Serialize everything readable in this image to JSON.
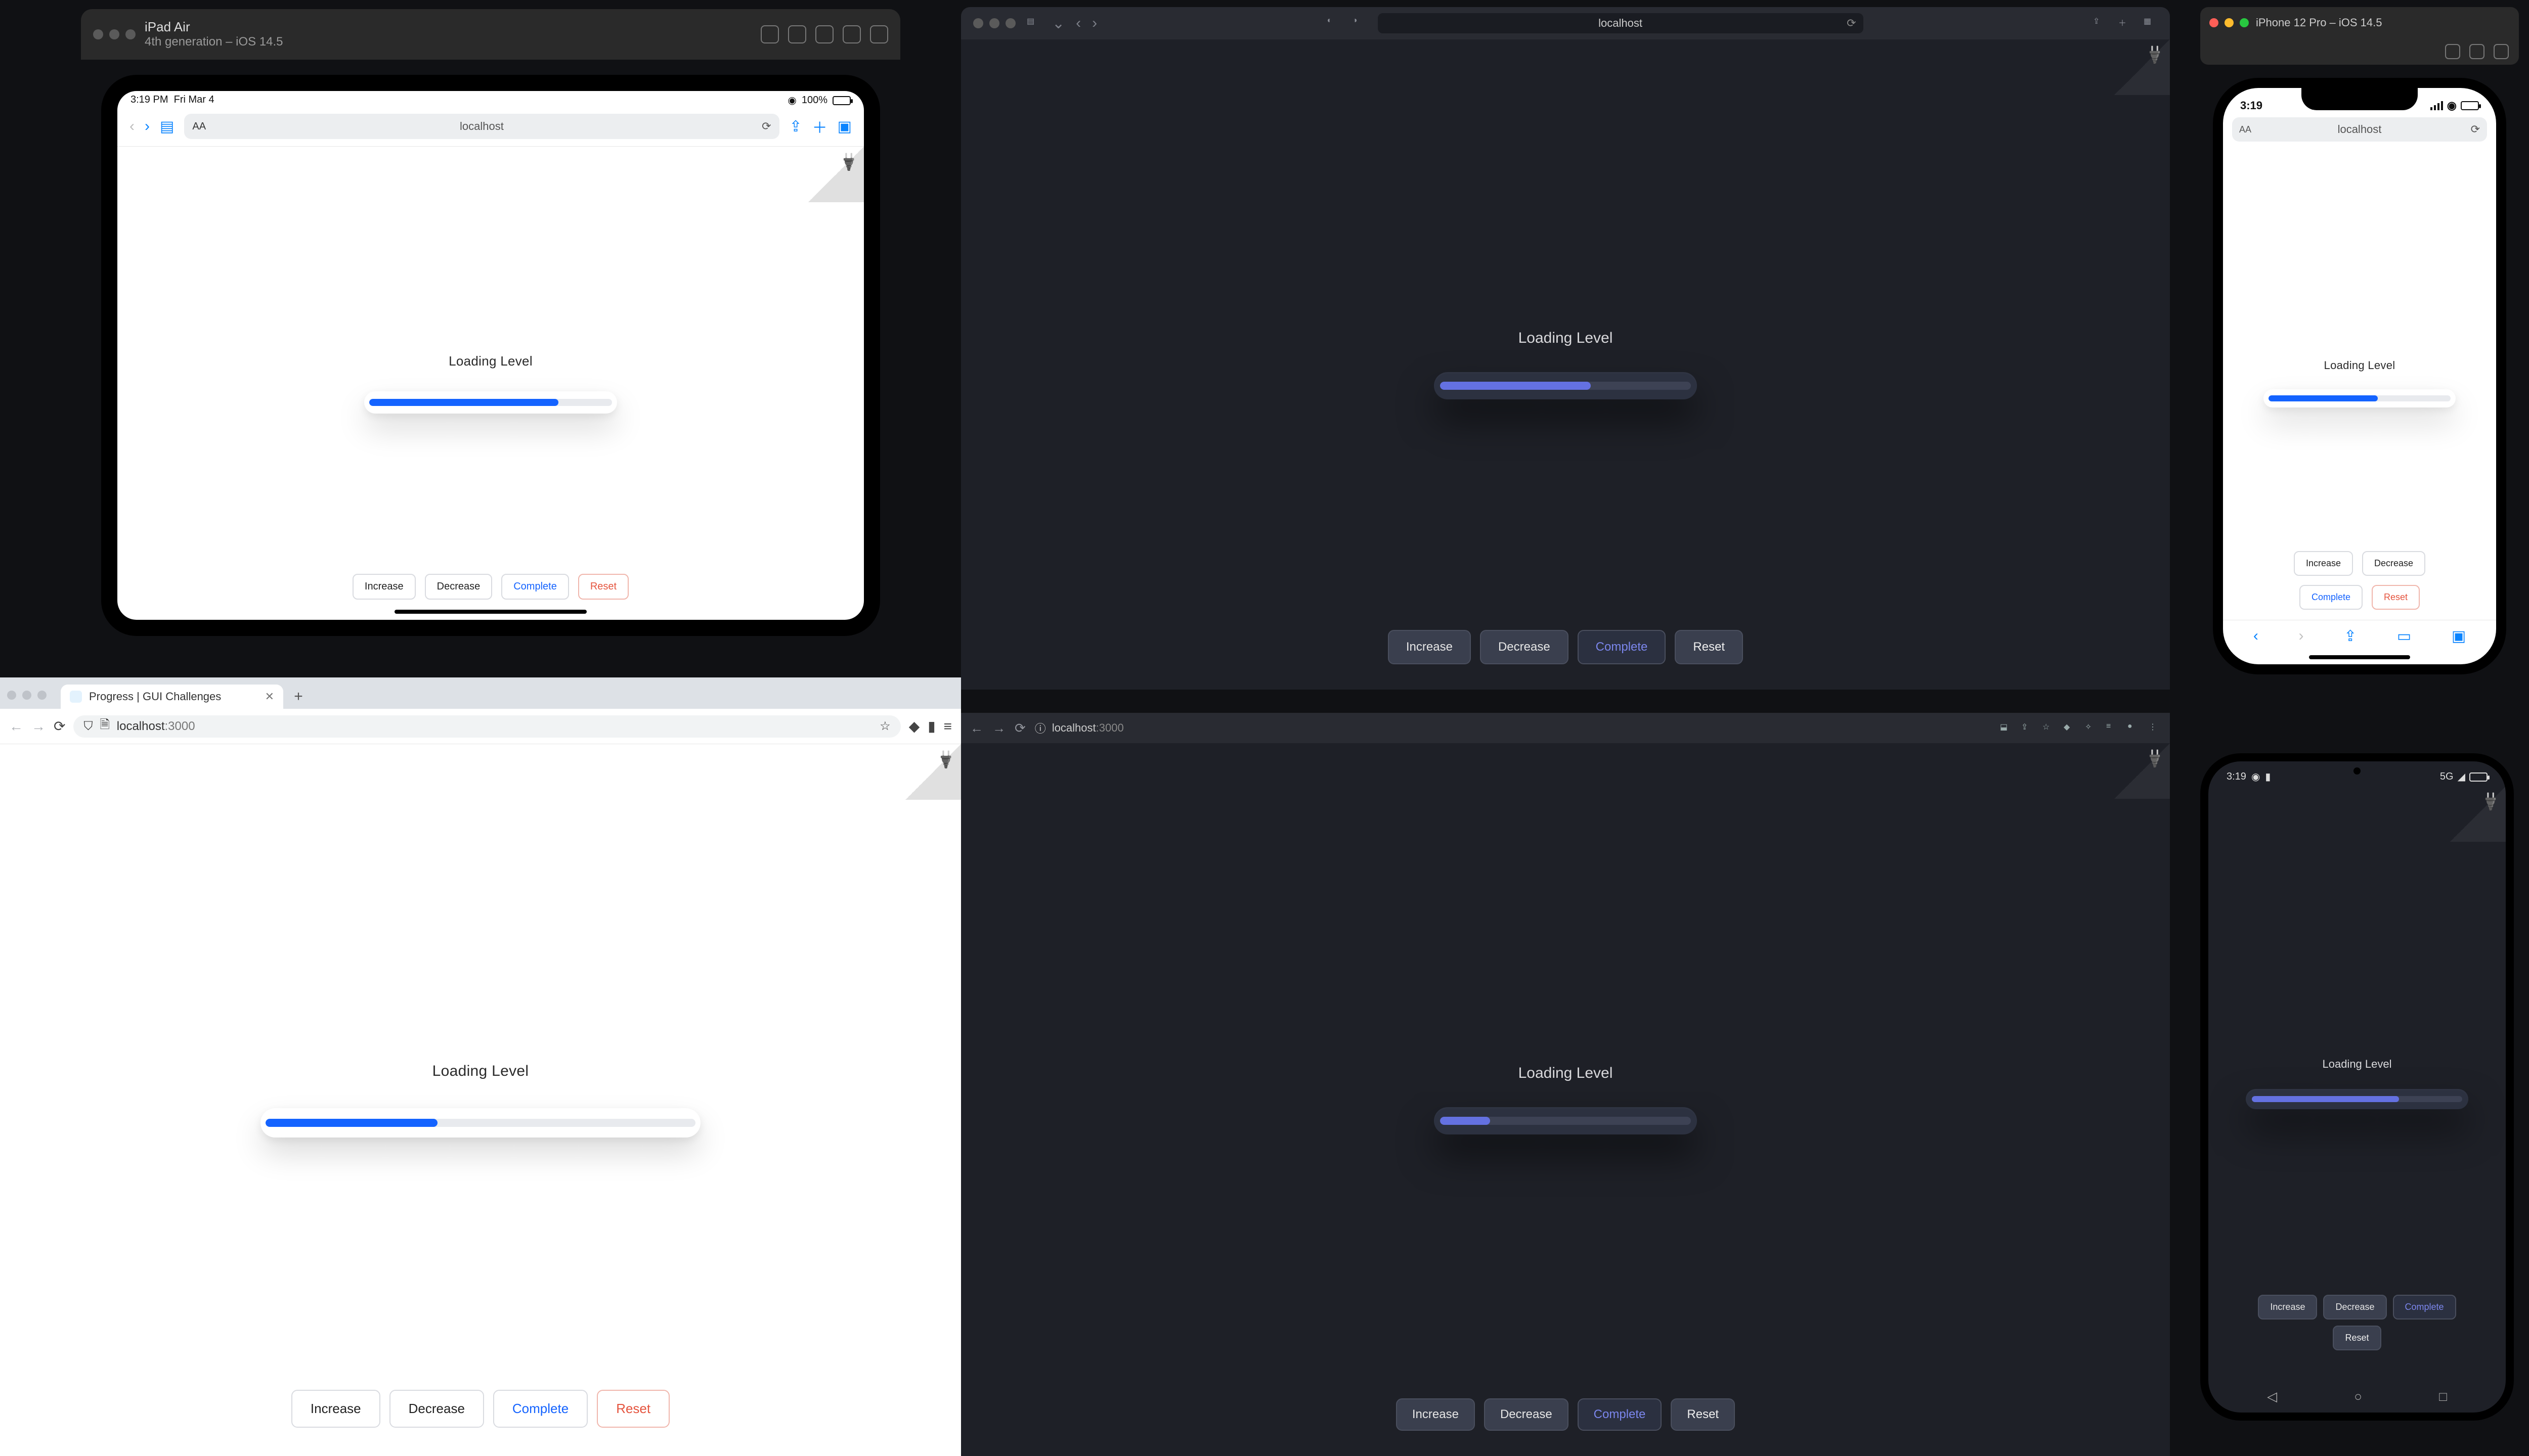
{
  "sim_ipad": {
    "device_name": "iPad Air",
    "device_sub": "4th generation – iOS 14.5",
    "status_time": "3:19 PM",
    "status_date": "Fri Mar 4",
    "status_batt": "100%",
    "addr": "localhost",
    "label": "Loading Level",
    "progress_pct": 78,
    "buttons": {
      "increase": "Increase",
      "decrease": "Decrease",
      "complete": "Complete",
      "reset": "Reset"
    }
  },
  "safari": {
    "addr": "localhost",
    "label": "Loading Level",
    "progress_pct": 60,
    "buttons": {
      "increase": "Increase",
      "decrease": "Decrease",
      "complete": "Complete",
      "reset": "Reset"
    }
  },
  "sim_iphone": {
    "device_name": "iPhone 12 Pro – iOS 14.5",
    "status_time": "3:19",
    "addr": "localhost",
    "label": "Loading Level",
    "progress_pct": 60,
    "buttons": {
      "increase": "Increase",
      "decrease": "Decrease",
      "complete": "Complete",
      "reset": "Reset"
    }
  },
  "chrome_light": {
    "tab_title": "Progress | GUI Challenges",
    "addr_host": "localhost",
    "addr_port": ":3000",
    "label": "Loading Level",
    "progress_pct": 40,
    "buttons": {
      "increase": "Increase",
      "decrease": "Decrease",
      "complete": "Complete",
      "reset": "Reset"
    }
  },
  "chrome_dark": {
    "addr_host": "localhost",
    "addr_port": ":3000",
    "label": "Loading Level",
    "progress_pct": 20,
    "buttons": {
      "increase": "Increase",
      "decrease": "Decrease",
      "complete": "Complete",
      "reset": "Reset"
    }
  },
  "android": {
    "status_time": "3:19",
    "status_net": "5G",
    "label": "Loading Level",
    "progress_pct": 70,
    "buttons": {
      "increase": "Increase",
      "decrease": "Decrease",
      "complete": "Complete",
      "reset": "Reset"
    }
  }
}
